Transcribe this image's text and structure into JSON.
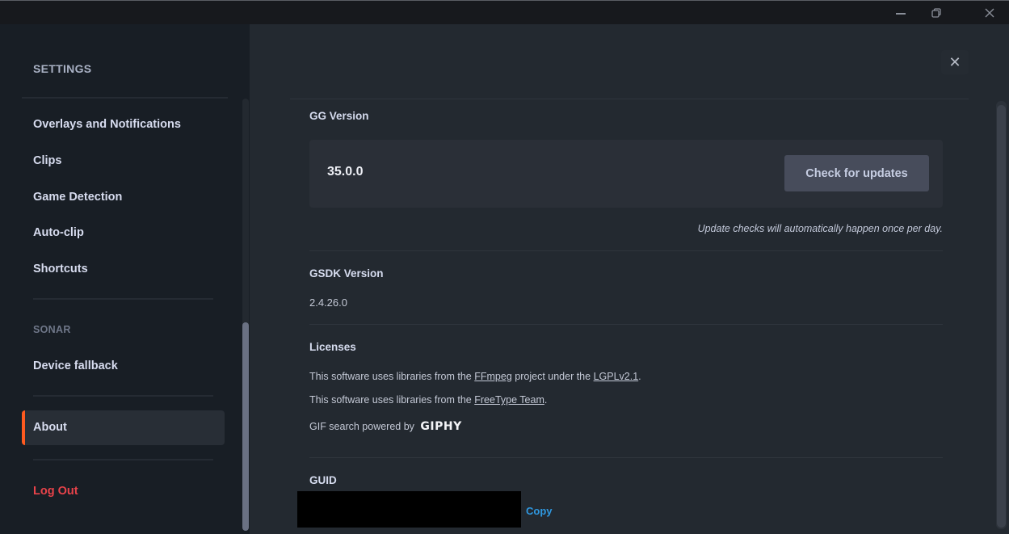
{
  "window": {
    "controls": {
      "minimize": "minimize-icon",
      "restore": "restore-icon",
      "close": "close-icon",
      "close_glyph": "✕"
    }
  },
  "sidebar": {
    "title": "SETTINGS",
    "items": [
      {
        "label": "Overlays and Notifications"
      },
      {
        "label": "Clips"
      },
      {
        "label": "Game Detection"
      },
      {
        "label": "Auto-clip"
      },
      {
        "label": "Shortcuts"
      }
    ],
    "sonar_section": "SONAR",
    "sonar_items": [
      {
        "label": "Device fallback"
      }
    ],
    "active_item": "About",
    "logout": "Log Out",
    "accent_color": "#ff5a1f",
    "logout_color": "#e8434a"
  },
  "main": {
    "close_glyph": "✕",
    "gg_version": {
      "title": "GG Version",
      "value": "35.0.0",
      "check_button": "Check for updates",
      "note": "Update checks will automatically happen once per day."
    },
    "gsdk_version": {
      "title": "GSDK Version",
      "value": "2.4.26.0"
    },
    "licenses": {
      "title": "Licenses",
      "line1_prefix": "This software uses libraries from the ",
      "line1_link1": "FFmpeg",
      "line1_middle": " project under the ",
      "line1_link2": "LGPLv2.1",
      "line1_suffix": ".",
      "line2_prefix": "This software uses libraries from the ",
      "line2_link": "FreeType Team",
      "line2_suffix": ".",
      "line3_prefix": "GIF search powered by",
      "giphy_logo": "GIPHY"
    },
    "guid": {
      "title": "GUID",
      "copy": "Copy",
      "link_color": "#2f98e0"
    }
  }
}
